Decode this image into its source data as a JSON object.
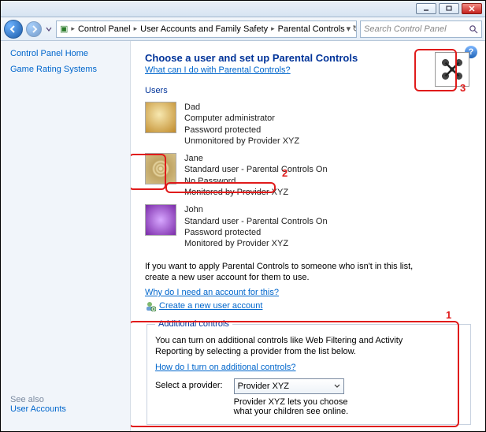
{
  "window": {
    "min_tooltip": "Minimize",
    "max_tooltip": "Maximize",
    "close_tooltip": "Close"
  },
  "breadcrumb": {
    "root_icon": "control-panel-icon",
    "items": [
      "Control Panel",
      "User Accounts and Family Safety",
      "Parental Controls"
    ]
  },
  "search": {
    "placeholder": "Search Control Panel"
  },
  "leftnav": {
    "home": "Control Panel Home",
    "game_rating": "Game Rating Systems",
    "see_also": "See also",
    "user_accounts": "User Accounts"
  },
  "help_tooltip": "?",
  "page": {
    "title": "Choose a user and set up Parental Controls",
    "subtitle_link": "What can I do with Parental Controls?",
    "users_label": "Users",
    "users": [
      {
        "name": "Dad",
        "role": "Computer administrator",
        "password": "Password protected",
        "status": "Unmonitored by Provider XYZ"
      },
      {
        "name": "Jane",
        "role": "Standard user - Parental Controls On",
        "password": "No Password",
        "status": "Monitored by Provider XYZ"
      },
      {
        "name": "John",
        "role": "Standard user - Parental Controls On",
        "password": "Password protected",
        "status": "Monitored by Provider XYZ"
      }
    ],
    "new_user_desc": "If you want to apply Parental Controls to someone who isn't in this list, create a new user account for them to use.",
    "why_account_link": "Why do I need an account for this?",
    "create_account_link": "Create a new user account"
  },
  "additional": {
    "legend": "Additional controls",
    "desc": "You can turn on additional controls like Web Filtering and Activity Reporting by selecting a provider from the list below.",
    "how_link": "How do I turn on additional controls?",
    "select_label": "Select a provider:",
    "selected": "Provider XYZ",
    "provider_desc": "Provider XYZ lets you choose what your children see online."
  },
  "annotations": {
    "a1": "1",
    "a2": "2",
    "a3": "3"
  }
}
